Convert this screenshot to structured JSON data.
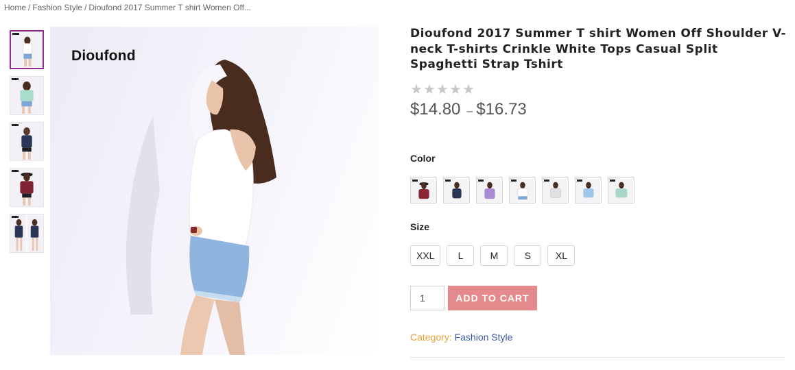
{
  "breadcrumb": {
    "home": "Home",
    "separator": "/",
    "category": "Fashion Style",
    "current": "Dioufond 2017 Summer T shirt Women Off..."
  },
  "gallery": {
    "brand_watermark": "Dioufond",
    "thumbnail_count": 5,
    "active_thumbnail": 1
  },
  "product": {
    "title": "Dioufond 2017 Summer T shirt Women Off Shoulder V-neck T-shirts Crinkle White Tops Casual Split Spaghetti Strap Tshirt",
    "rating_stars": 5,
    "rating_filled": 0,
    "price_low": "$14.80",
    "price_separator": "–",
    "price_high": "$16.73"
  },
  "color": {
    "label": "Color",
    "swatch_colors": [
      "#8a2433",
      "#2c3552",
      "#a88bd2",
      "#f2f2f2",
      "#e4e1e3",
      "#9cc7ea",
      "#a8d8c8"
    ]
  },
  "size": {
    "label": "Size",
    "options": [
      "XXL",
      "L",
      "M",
      "S",
      "XL"
    ]
  },
  "cart": {
    "quantity": "1",
    "add_button": "ADD TO CART"
  },
  "category": {
    "label": "Category:",
    "value": "Fashion Style"
  },
  "colors": {
    "add_to_cart_bg": "#e58a8c",
    "active_thumb_border": "#8e2d8e",
    "category_label": "#e8a13a",
    "category_link": "#3a5ba5"
  }
}
